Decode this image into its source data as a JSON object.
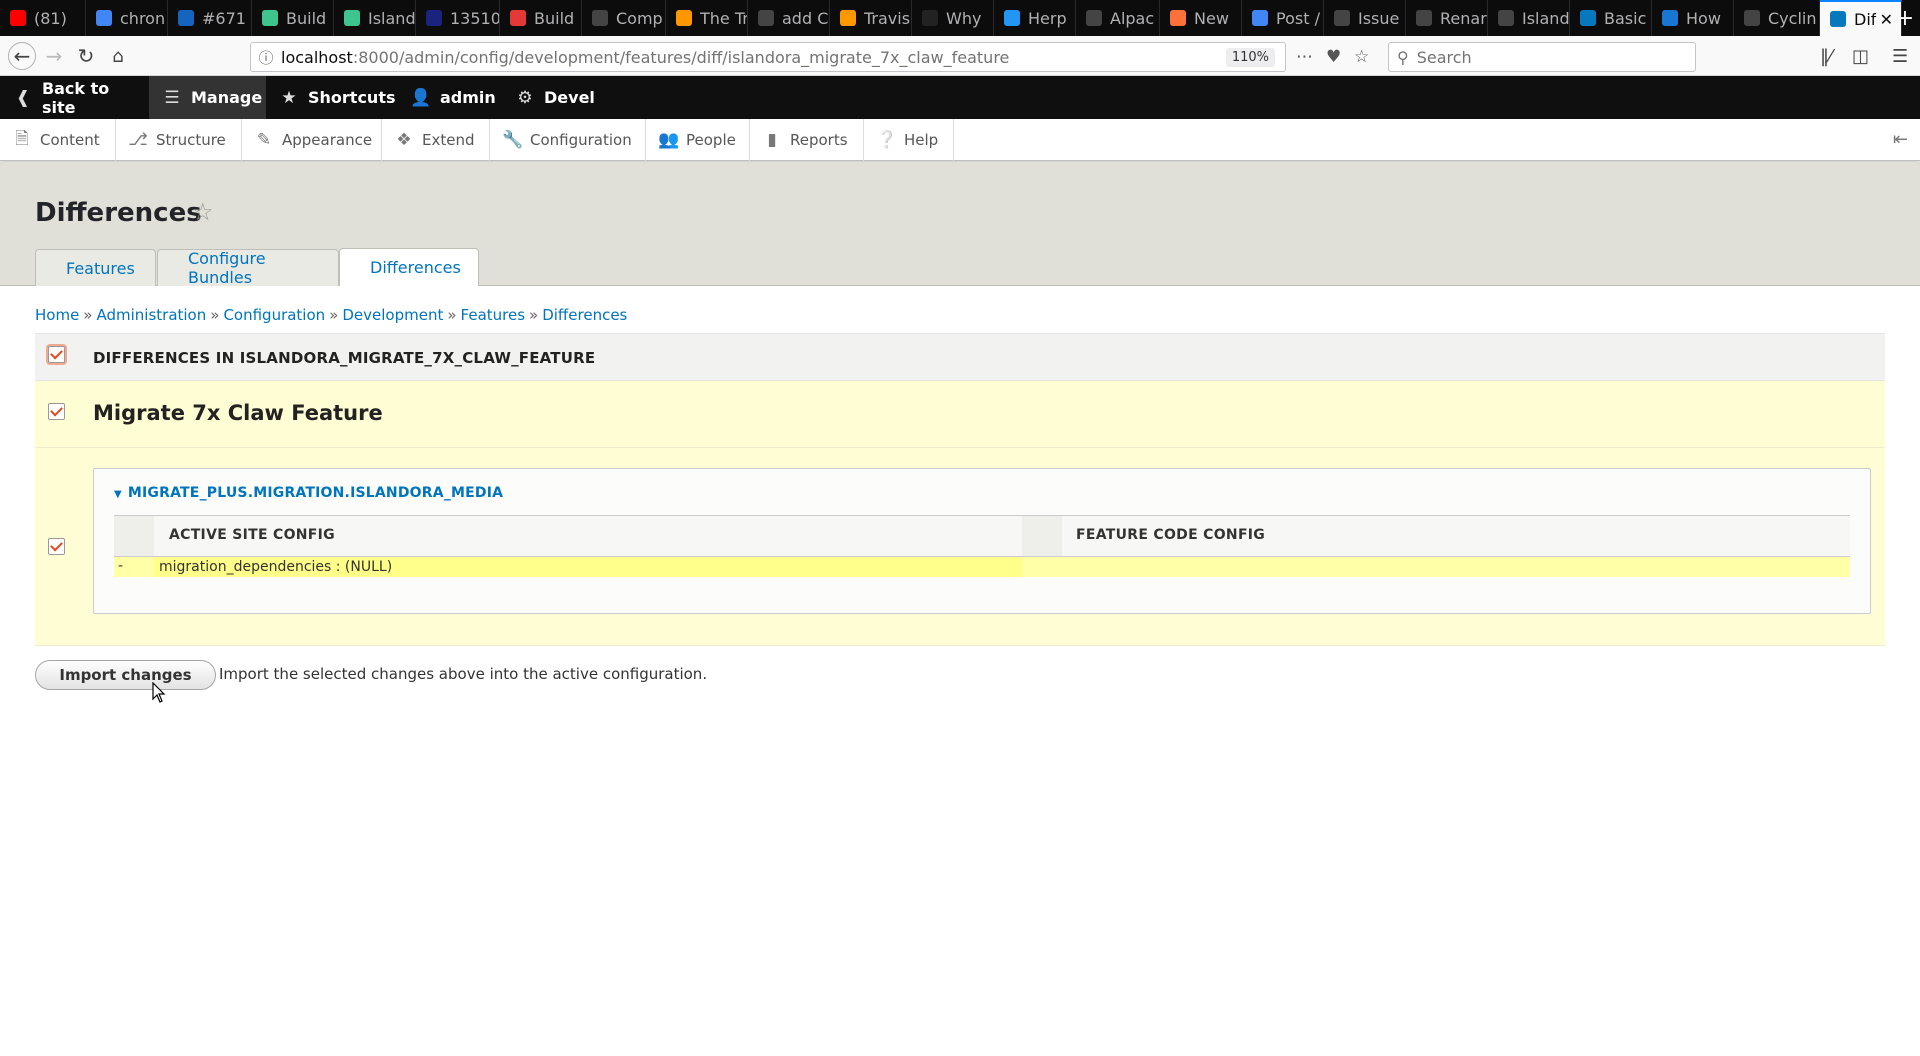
{
  "browser": {
    "tabs": [
      {
        "label": "(81)",
        "favicon_color": "#ff0000",
        "icon": "youtube-icon"
      },
      {
        "label": "chron",
        "favicon_color": "#4285f4",
        "icon": "google-icon"
      },
      {
        "label": "#671",
        "favicon_color": "#1565c0",
        "icon": "one-password-icon"
      },
      {
        "label": "Build",
        "favicon_color": "#3ec48f",
        "icon": "build-icon"
      },
      {
        "label": "Island",
        "favicon_color": "#3ec48f",
        "icon": "build-icon"
      },
      {
        "label": "13510",
        "favicon_color": "#1a237e",
        "icon": "ticket-icon"
      },
      {
        "label": "Build",
        "favicon_color": "#e53935",
        "icon": "build-icon"
      },
      {
        "label": "Comp",
        "favicon_color": "#444444",
        "icon": "github-icon"
      },
      {
        "label": "The Tr",
        "favicon_color": "#ff9800",
        "icon": "travis-icon"
      },
      {
        "label": "add C",
        "favicon_color": "#444444",
        "icon": "github-icon"
      },
      {
        "label": "Travis",
        "favicon_color": "#ff9800",
        "icon": "travis-icon"
      },
      {
        "label": "Why",
        "favicon_color": "#222222",
        "icon": "r-icon"
      },
      {
        "label": "Herp",
        "favicon_color": "#2196f3",
        "icon": "drupal-icon"
      },
      {
        "label": "Alpac",
        "favicon_color": "#444444",
        "icon": "github-icon"
      },
      {
        "label": "New",
        "favicon_color": "#ff7139",
        "icon": "firefox-icon"
      },
      {
        "label": "Post /",
        "favicon_color": "#4285f4",
        "icon": "post-icon"
      },
      {
        "label": "Issue",
        "favicon_color": "#444444",
        "icon": "github-icon"
      },
      {
        "label": "Renar",
        "favicon_color": "#444444",
        "icon": "github-icon"
      },
      {
        "label": "Island",
        "favicon_color": "#444444",
        "icon": "github-icon"
      },
      {
        "label": "Basic",
        "favicon_color": "#0678be",
        "icon": "drupal-icon"
      },
      {
        "label": "How",
        "favicon_color": "#1976d2",
        "icon": "jira-icon"
      },
      {
        "label": "Cyclin",
        "favicon_color": "#444444",
        "icon": "github-icon"
      },
      {
        "label": "Dif",
        "favicon_color": "#0678be",
        "icon": "drupal-icon",
        "active": true
      }
    ],
    "url_host": "localhost",
    "url_path": ":8000/admin/config/development/features/diff/islandora_migrate_7x_claw_feature",
    "zoom": "110%",
    "search_placeholder": "Search"
  },
  "toolbar": {
    "back_to_site": "Back to site",
    "manage": "Manage",
    "shortcuts": "Shortcuts",
    "user": "admin",
    "devel": "Devel"
  },
  "tray": {
    "items": [
      "Content",
      "Structure",
      "Appearance",
      "Extend",
      "Configuration",
      "People",
      "Reports",
      "Help"
    ]
  },
  "page": {
    "title": "Differences",
    "tabs": [
      "Features",
      "Configure Bundles",
      "Differences"
    ],
    "active_tab": "Differences"
  },
  "breadcrumb": [
    "Home",
    "Administration",
    "Configuration",
    "Development",
    "Features",
    "Differences"
  ],
  "diff": {
    "header": "DIFFERENCES IN ISLANDORA_MIGRATE_7X_CLAW_FEATURE",
    "feature_title": "Migrate 7x Claw Feature",
    "config_item": "MIGRATE_PLUS.MIGRATION.ISLANDORA_MEDIA",
    "col_active": "ACTIVE SITE CONFIG",
    "col_feature": "FEATURE CODE CONFIG",
    "line_marker": "-",
    "line_text": "migration_dependencies : (NULL)"
  },
  "actions": {
    "import_label": "Import changes",
    "import_description": "Import the selected changes above into the active configuration."
  },
  "colors": {
    "link": "#0074bd",
    "diff_highlight": "#fffdd3",
    "deleted_line": "#ffff8a",
    "checkbox_check": "#e24a1f"
  }
}
